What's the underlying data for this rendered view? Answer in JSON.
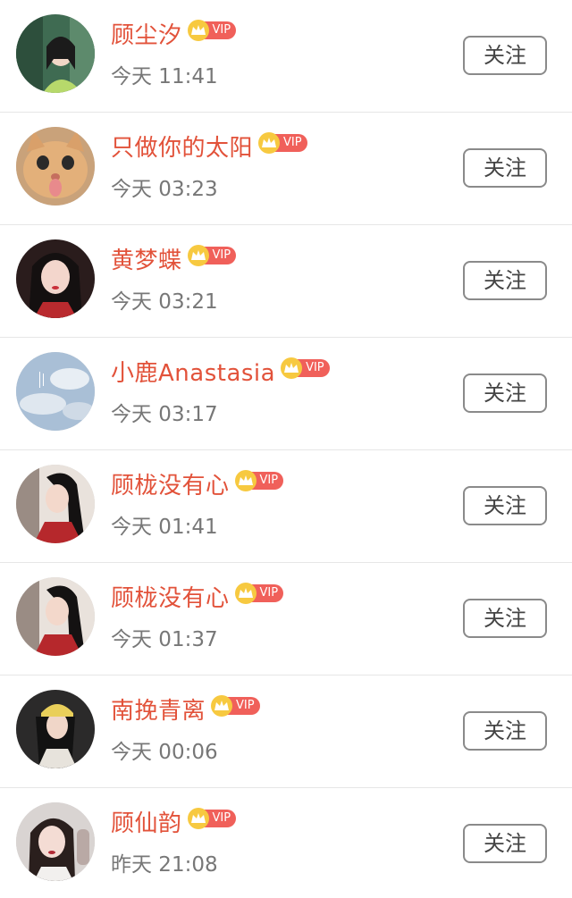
{
  "users": [
    {
      "name": "顾尘汐",
      "vip": true,
      "vip_label": "VIP",
      "time": "今天 11:41",
      "follow_label": "关注",
      "avatar_icon": "avatar-girl-photo"
    },
    {
      "name": "只做你的太阳",
      "vip": true,
      "vip_label": "VIP",
      "time": "今天 03:23",
      "follow_label": "关注",
      "avatar_icon": "avatar-cat-photo"
    },
    {
      "name": "黄梦蝶",
      "vip": true,
      "vip_label": "VIP",
      "time": "今天 03:21",
      "follow_label": "关注",
      "avatar_icon": "avatar-girl-photo"
    },
    {
      "name": "小鹿Anastasia",
      "vip": true,
      "vip_label": "VIP",
      "time": "今天 03:17",
      "follow_label": "关注",
      "avatar_icon": "avatar-sky-photo"
    },
    {
      "name": "顾栊没有心",
      "vip": true,
      "vip_label": "VIP",
      "time": "今天 01:41",
      "follow_label": "关注",
      "avatar_icon": "avatar-girl-photo"
    },
    {
      "name": "顾栊没有心",
      "vip": true,
      "vip_label": "VIP",
      "time": "今天 01:37",
      "follow_label": "关注",
      "avatar_icon": "avatar-girl-photo"
    },
    {
      "name": "南挽青离",
      "vip": true,
      "vip_label": "VIP",
      "time": "今天 00:06",
      "follow_label": "关注",
      "avatar_icon": "avatar-girl-photo"
    },
    {
      "name": "顾仙韵",
      "vip": true,
      "vip_label": "VIP",
      "time": "昨天 21:08",
      "follow_label": "关注",
      "avatar_icon": "avatar-girl-photo"
    }
  ],
  "colors": {
    "name": "#e2523a",
    "vip_tag": "#f0605a",
    "crown": "#f7c940",
    "time": "#777777",
    "button_border": "#8a8a8a"
  }
}
